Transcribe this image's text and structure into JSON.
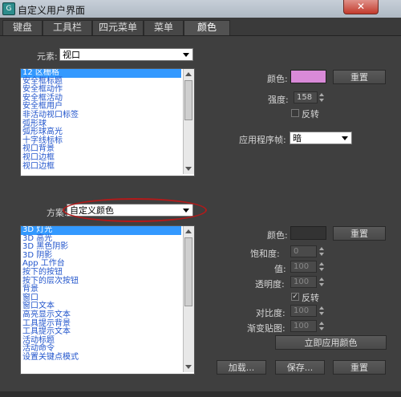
{
  "window": {
    "title": "自定义用户界面",
    "icon": "app-icon"
  },
  "tabs": [
    "键盘",
    "工具栏",
    "四元菜单",
    "菜单",
    "颜色"
  ],
  "active_tab": 4,
  "elements": {
    "label": "元素:",
    "selected": "视口",
    "items": [
      "12 区栅格",
      "安全框标题",
      "安全框动作",
      "安全框活动",
      "安全框用户",
      "非活动视口标签",
      "弧形球",
      "弧形球高光",
      "十字线标标",
      "视口背景",
      "视口边框",
      "视口边框"
    ]
  },
  "right_top": {
    "color_label": "颜色:",
    "color": "#d98ad8",
    "reset_label": "重置",
    "intensity_label": "强度:",
    "intensity_value": "158",
    "invert_label": "反转",
    "app_frame_label": "应用程序帧:",
    "app_frame_value": "暗"
  },
  "scheme": {
    "label": "方案:",
    "selected": "自定义颜色",
    "items": [
      "3D 灯光",
      "3D 高光",
      "3D 黑色阴影",
      "3D 阴影",
      "App 工作台",
      "按下的按钮",
      "按下的层次按钮",
      "背景",
      "窗口",
      "窗口文本",
      "高亮显示文本",
      "工具提示背景",
      "工具提示文本",
      "活动标题",
      "活动命令",
      "设置关键点模式"
    ]
  },
  "right_bottom": {
    "color_label": "颜色:",
    "color": "#333333",
    "reset_label": "重置",
    "saturation_label": "饱和度:",
    "saturation_value": "0",
    "value_label": "值:",
    "value_value": "100",
    "transparency_label": "透明度:",
    "transparency_value": "100",
    "invert_label": "反转",
    "contrast_label": "对比度:",
    "contrast_value": "100",
    "gradient_label": "渐变贴图:",
    "gradient_value": "100",
    "apply_label": "立即应用颜色"
  },
  "footer": {
    "load_label": "加载...",
    "save_label": "保存...",
    "reset_label": "重置"
  },
  "colors": {
    "annotation_oval": "#b21a1a",
    "selection": "#3399ff"
  }
}
